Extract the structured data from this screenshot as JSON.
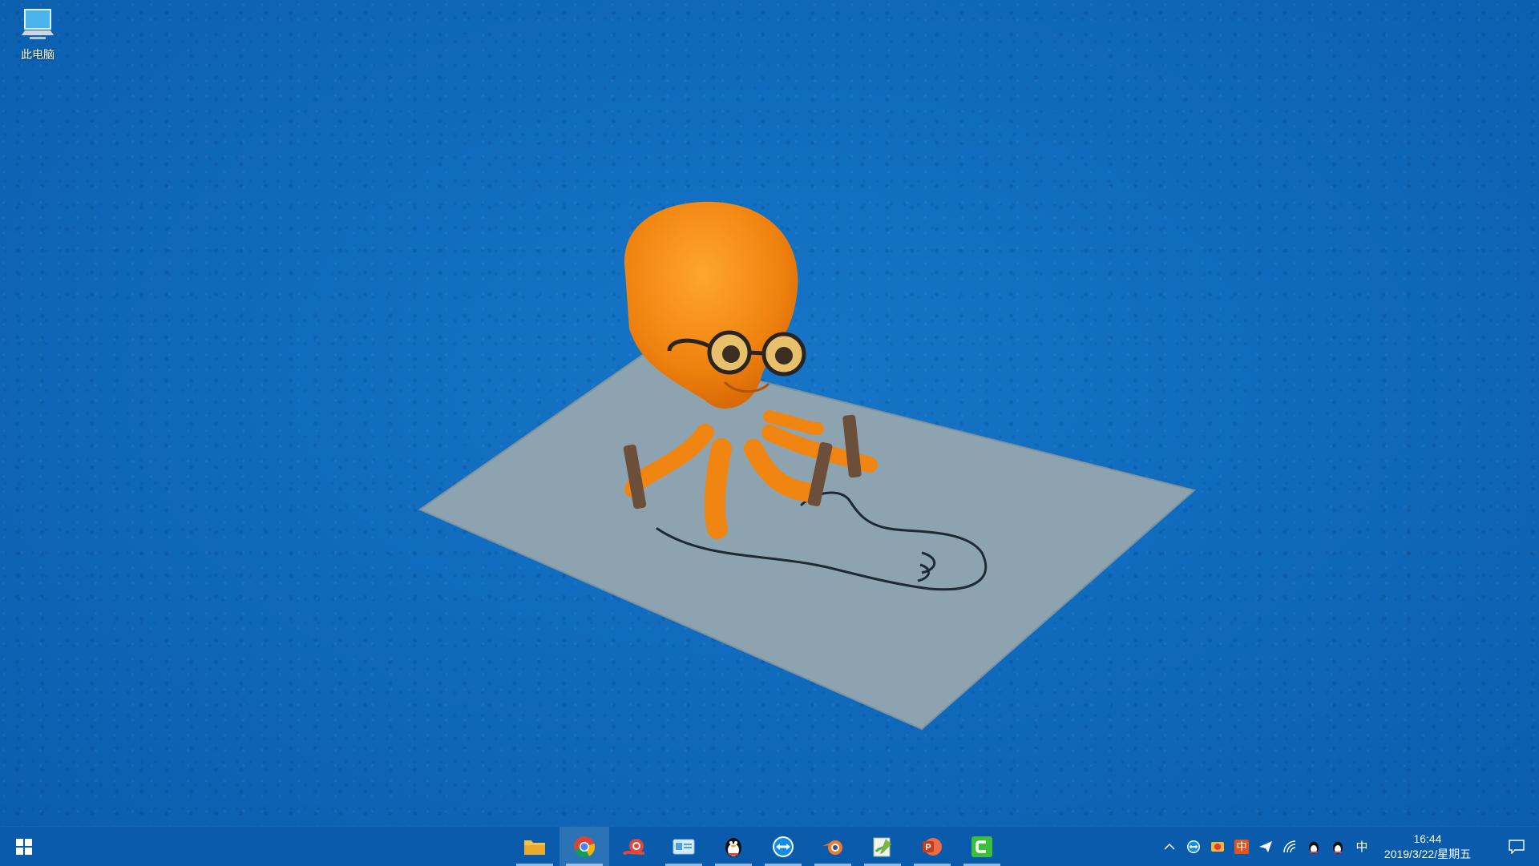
{
  "desktop": {
    "icons": [
      {
        "label": "此电脑",
        "icon": "computer-icon"
      }
    ]
  },
  "taskbar": {
    "start_icon": "windows-logo-icon",
    "apps": [
      {
        "name": "file-explorer",
        "icon": "folder-icon",
        "running": true,
        "active": false
      },
      {
        "name": "chrome",
        "icon": "chrome-icon",
        "running": true,
        "active": true
      },
      {
        "name": "snail-app",
        "icon": "snail-icon",
        "running": false,
        "active": false
      },
      {
        "name": "id-card-app",
        "icon": "id-card-icon",
        "running": true,
        "active": false
      },
      {
        "name": "qq",
        "icon": "penguin-icon",
        "running": true,
        "active": false
      },
      {
        "name": "teamviewer",
        "icon": "teamviewer-icon",
        "running": true,
        "active": false
      },
      {
        "name": "blender",
        "icon": "blender-icon",
        "running": true,
        "active": false
      },
      {
        "name": "notepad-app",
        "icon": "green-notepad-icon",
        "running": true,
        "active": false
      },
      {
        "name": "powerpoint",
        "icon": "powerpoint-icon",
        "running": true,
        "active": false
      },
      {
        "name": "camtasia",
        "icon": "camtasia-icon",
        "running": true,
        "active": false
      }
    ],
    "tray": {
      "chevron_icon": "chevron-up-icon",
      "ime": "中",
      "tray_ime_badge": "中"
    },
    "clock": {
      "time": "16:44",
      "date": "2019/3/22/星期五"
    },
    "notification_icon": "notification-icon"
  },
  "colors": {
    "desktop_blue": "#0f69bb",
    "taskbar": "#0a5bab",
    "octopus_orange": "#f28a14",
    "paper_gray": "#8ea3b0"
  }
}
